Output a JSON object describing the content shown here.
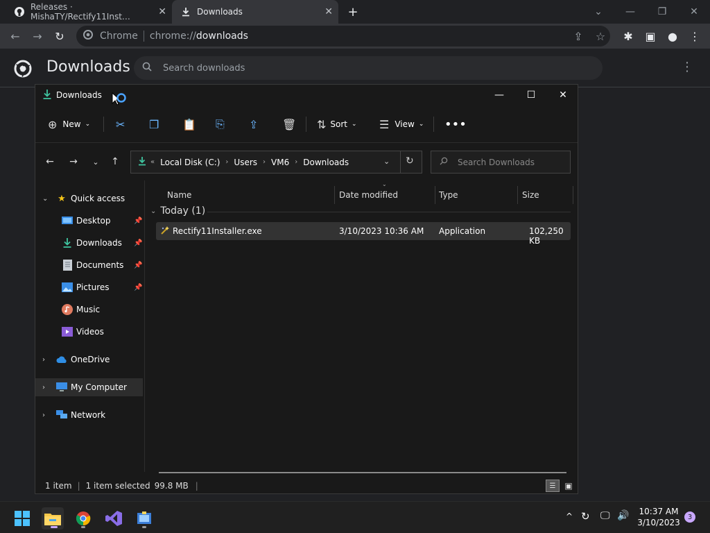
{
  "chrome": {
    "tabs": [
      {
        "label": "Releases · MishaTY/Rectify11Inst…",
        "icon": "github-icon"
      },
      {
        "label": "Downloads",
        "icon": "download-icon"
      }
    ],
    "omnibox": {
      "site_label": "Chrome",
      "url_prefix": "chrome://",
      "url_host": "downloads"
    },
    "downloads_page": {
      "title": "Downloads",
      "search_placeholder": "Search downloads"
    }
  },
  "explorer": {
    "title": "Downloads",
    "toolbar": {
      "new_label": "New",
      "sort_label": "Sort",
      "view_label": "View"
    },
    "breadcrumb": [
      "Local Disk (C:)",
      "Users",
      "VM6",
      "Downloads"
    ],
    "search_placeholder": "Search Downloads",
    "sidebar": {
      "quick_access": "Quick access",
      "items": [
        "Desktop",
        "Downloads",
        "Documents",
        "Pictures",
        "Music",
        "Videos"
      ],
      "onedrive": "OneDrive",
      "my_computer": "My Computer",
      "network": "Network"
    },
    "columns": {
      "name": "Name",
      "date": "Date modified",
      "type": "Type",
      "size": "Size"
    },
    "group_label": "Today (1)",
    "file": {
      "name": "Rectify11Installer.exe",
      "date": "3/10/2023 10:36 AM",
      "type": "Application",
      "size": "102,250 KB"
    },
    "status": {
      "count": "1 item",
      "selected": "1 item selected",
      "size": "99.8 MB"
    }
  },
  "taskbar": {
    "time": "10:37 AM",
    "date": "3/10/2023",
    "notifications": "3"
  }
}
